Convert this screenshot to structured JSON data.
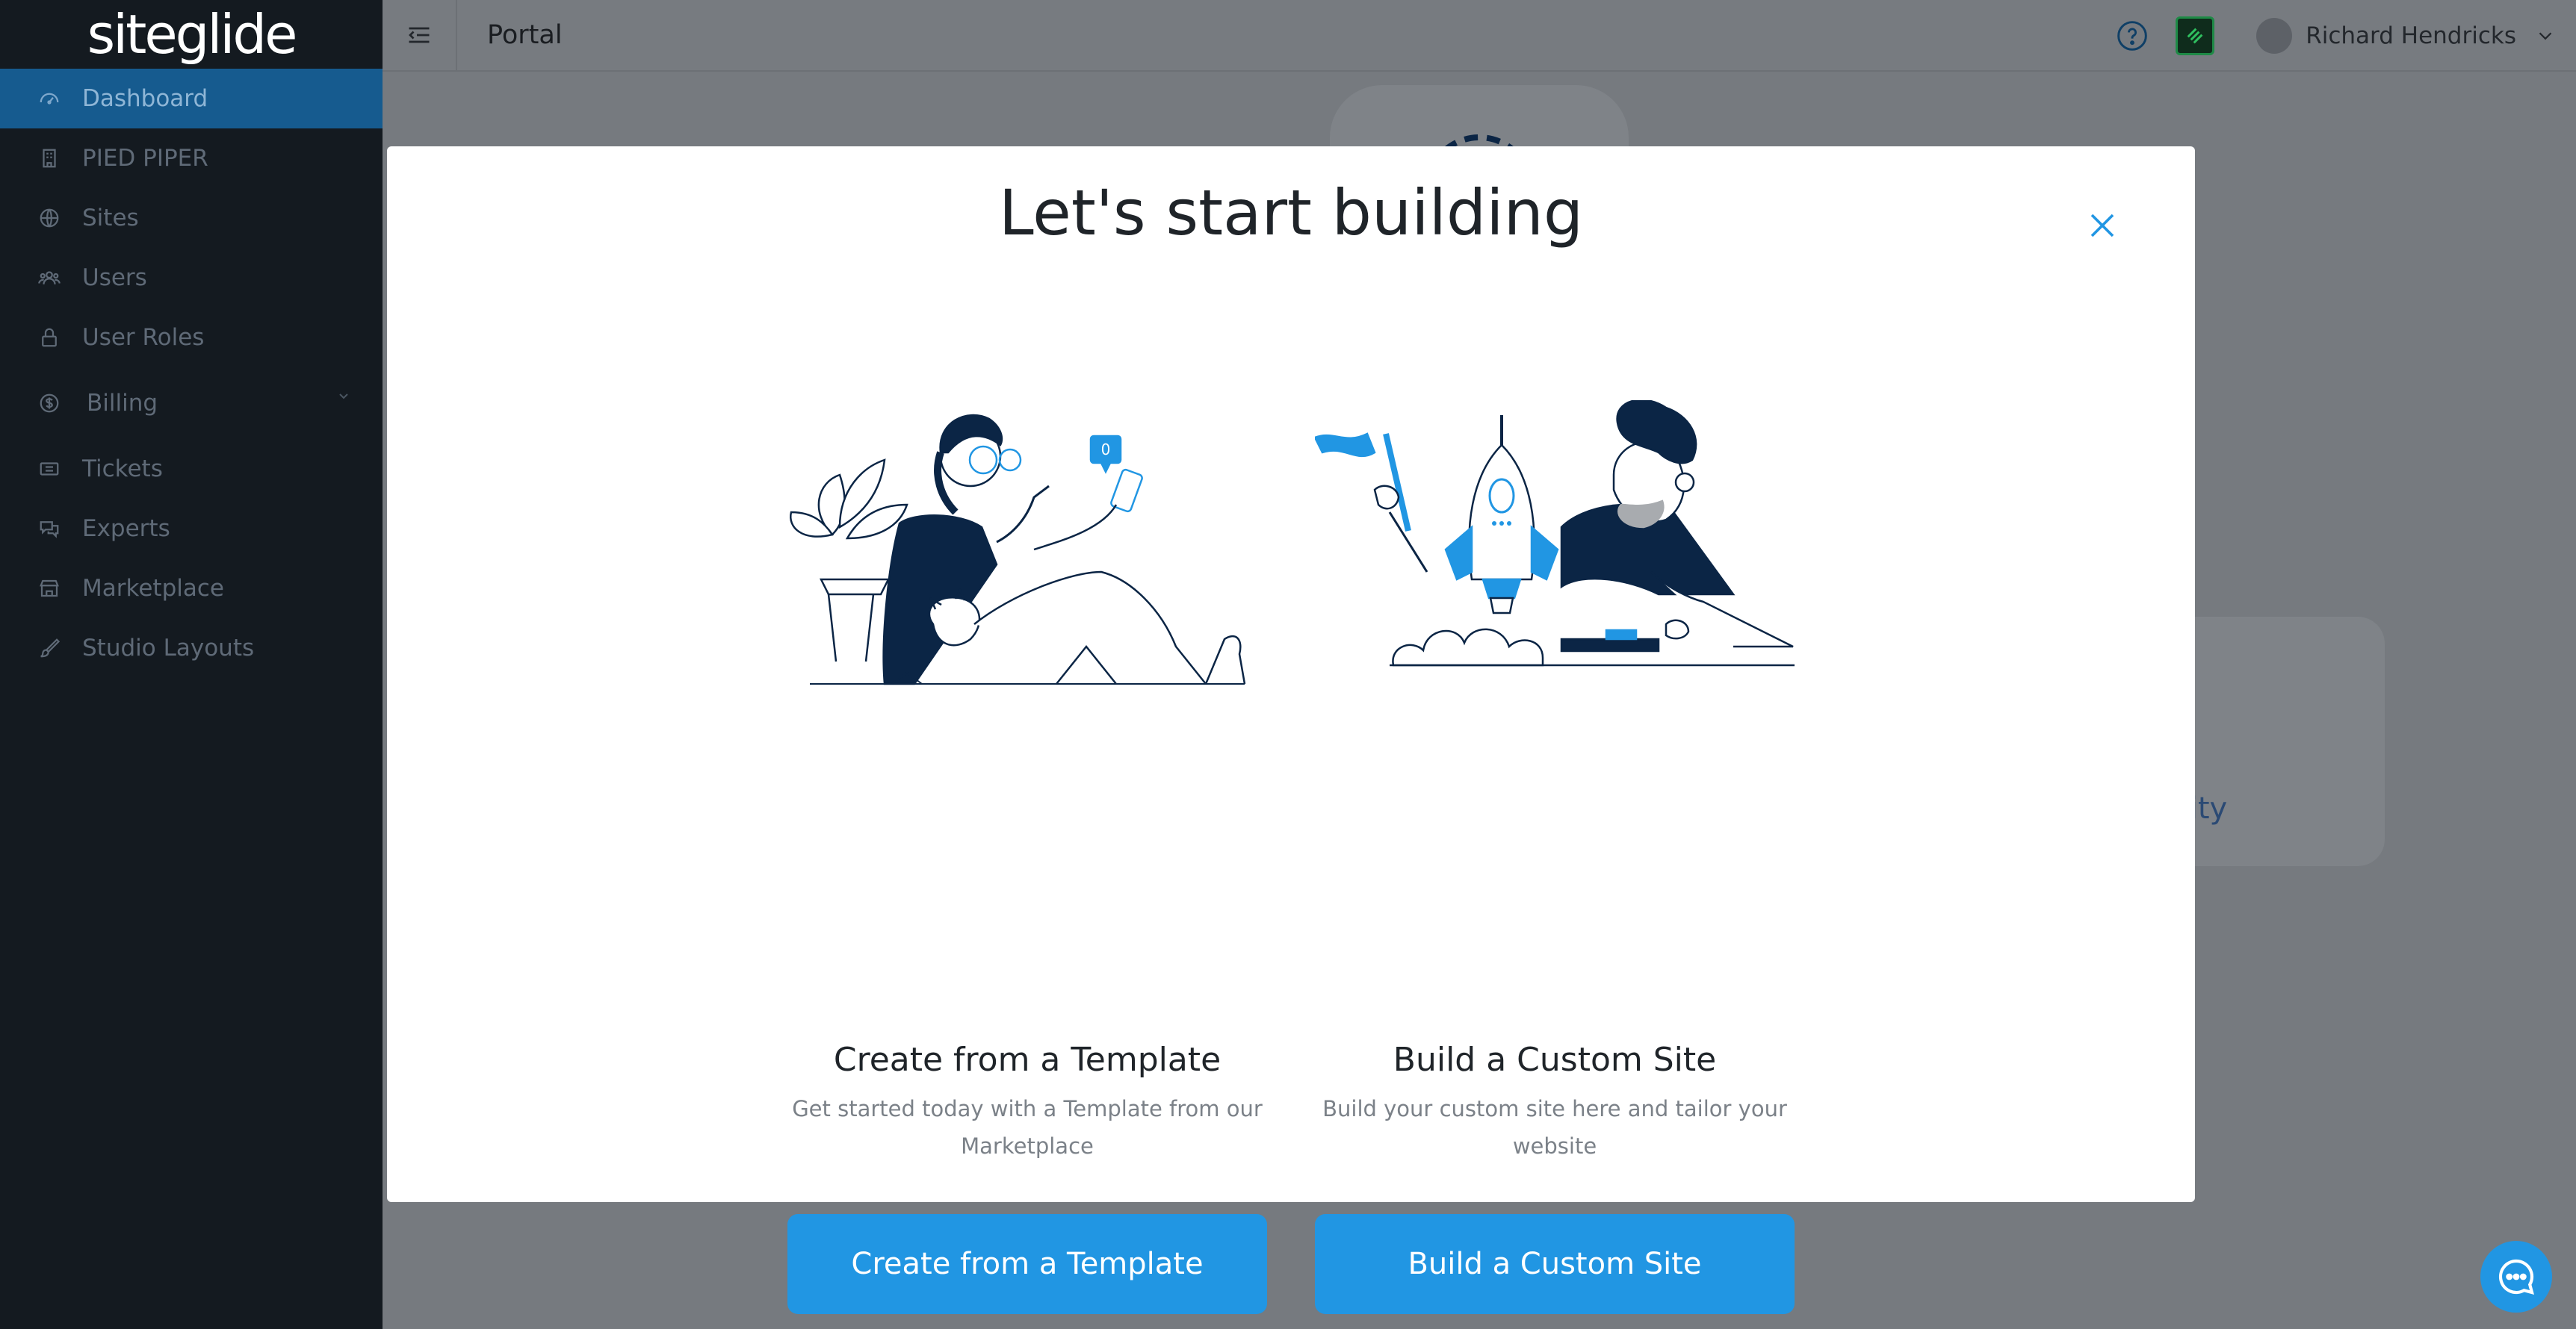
{
  "sidebar": {
    "logo_text": "siteglide",
    "items": [
      {
        "label": "Dashboard",
        "icon": "dashboard-icon"
      },
      {
        "label": "PIED PIPER",
        "icon": "building-icon"
      },
      {
        "label": "Sites",
        "icon": "globe-icon"
      },
      {
        "label": "Users",
        "icon": "users-icon"
      },
      {
        "label": "User Roles",
        "icon": "lock-icon"
      },
      {
        "label": "Billing",
        "icon": "dollar-icon"
      },
      {
        "label": "Tickets",
        "icon": "ticket-icon"
      },
      {
        "label": "Experts",
        "icon": "chat-icon"
      },
      {
        "label": "Marketplace",
        "icon": "store-icon"
      },
      {
        "label": "Studio Layouts",
        "icon": "brush-icon"
      }
    ]
  },
  "topbar": {
    "title": "Portal",
    "user_name": "Richard Hendricks"
  },
  "background": {
    "card_text": "unity"
  },
  "modal": {
    "title": "Let's start building",
    "options": [
      {
        "title": "Create from a Template",
        "description": "Get started today with a Template from our Marketplace",
        "button_label": "Create from a Template",
        "notification_count": "0"
      },
      {
        "title": "Build a Custom Site",
        "description": "Build your custom site here and tailor your website",
        "button_label": "Build a Custom Site"
      }
    ]
  },
  "colors": {
    "accent": "#2196e3",
    "sidebar_bg": "#141a20",
    "active_item_bg": "#165b8f",
    "overlay": "#767a7f",
    "navy": "#0b2545"
  }
}
